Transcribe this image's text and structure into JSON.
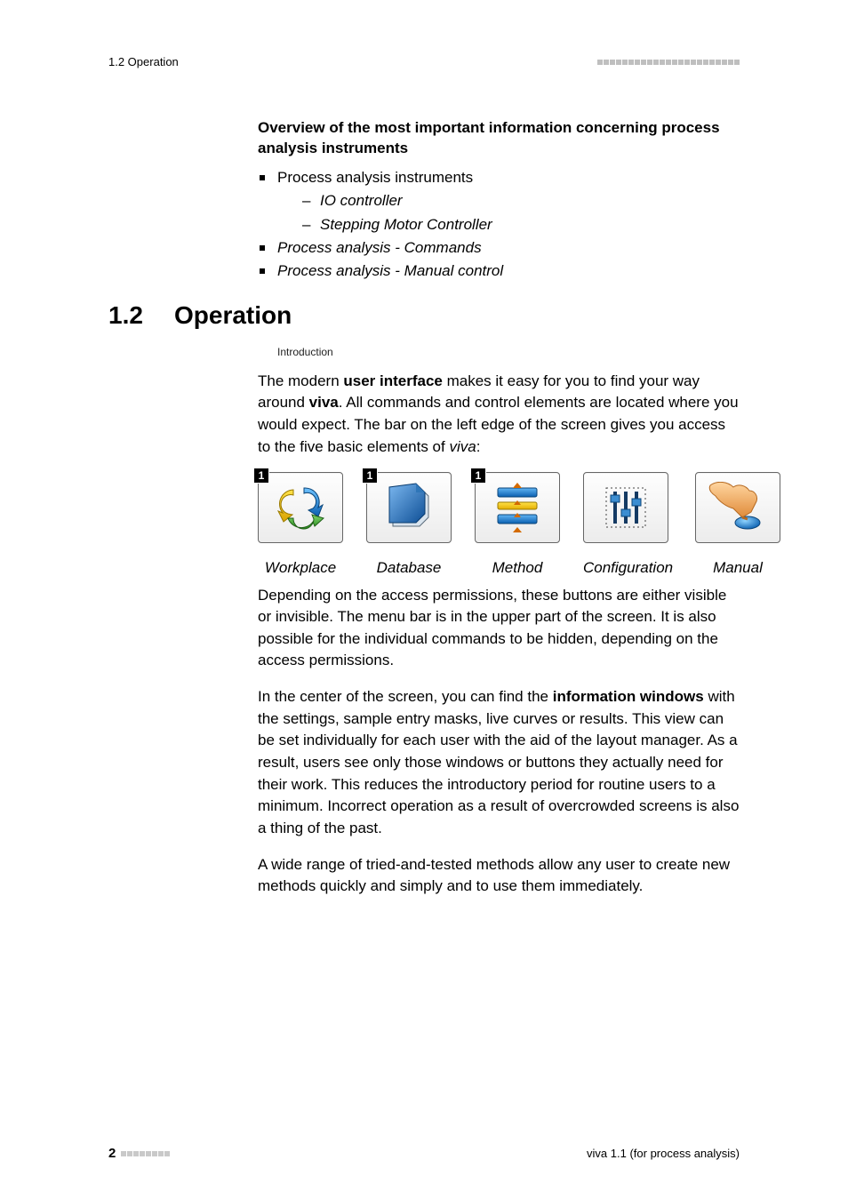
{
  "header": {
    "left": "1.2 Operation",
    "dash_count": 23
  },
  "overview": {
    "heading": "Overview of the most important information concerning process analysis instruments",
    "bullets": [
      {
        "text": "Process analysis instruments",
        "italic": false,
        "sub": [
          "IO controller",
          "Stepping Motor Controller"
        ]
      },
      {
        "text": "Process analysis - Commands",
        "italic": true,
        "sub": []
      },
      {
        "text": "Process analysis - Manual control",
        "italic": true,
        "sub": []
      }
    ]
  },
  "section": {
    "number": "1.2",
    "title": "Operation",
    "intro_label": "Introduction"
  },
  "paragraphs": {
    "p1_a": "The modern ",
    "p1_b": "user interface",
    "p1_c": " makes it easy for you to find your way around ",
    "p1_d": "viva",
    "p1_e": ". All commands and control elements are located where you would expect. The bar on the left edge of the screen gives you access to the five basic elements of ",
    "p1_f": "viva",
    "p1_g": ":",
    "p2": "Depending on the access permissions, these buttons are either visible or invisible. The menu bar is in the upper part of the screen. It is also possible for the individual commands to be hidden, depending on the access permissions.",
    "p3_a": "In the center of the screen, you can find the ",
    "p3_b": "information windows",
    "p3_c": " with the settings, sample entry masks, live curves or results. This view can be set individually for each user with the aid of the layout manager. As a result, users see only those windows or buttons they actually need for their work. This reduces the introductory period for routine users to a minimum. Incorrect operation as a result of overcrowded screens is also a thing of the past.",
    "p4": "A wide range of tried-and-tested methods allow any user to create new methods quickly and simply and to use them immediately."
  },
  "icons": [
    {
      "label": "Workplace",
      "badge": "1",
      "icon": "workplace-icon"
    },
    {
      "label": "Database",
      "badge": "1",
      "icon": "database-icon"
    },
    {
      "label": "Method",
      "badge": "1",
      "icon": "method-icon"
    },
    {
      "label": "Configuration",
      "badge": null,
      "icon": "configuration-icon"
    },
    {
      "label": "Manual",
      "badge": null,
      "icon": "manual-icon"
    }
  ],
  "footer": {
    "page_number": "2",
    "dash_count": 8,
    "right": "viva 1.1 (for process analysis)"
  }
}
